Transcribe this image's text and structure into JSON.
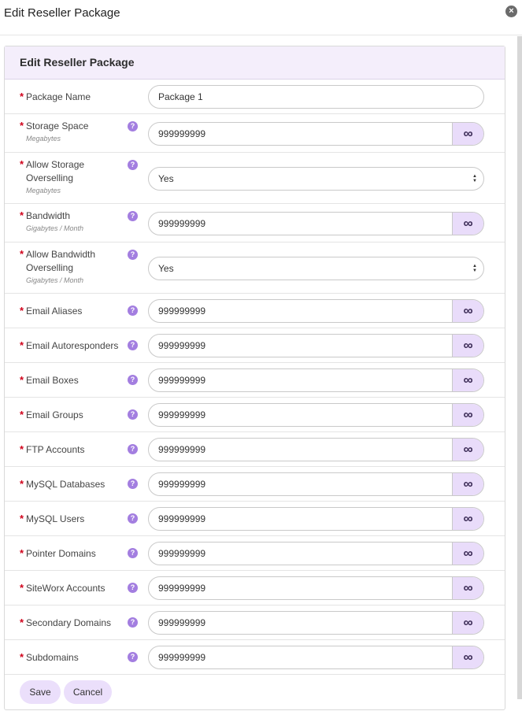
{
  "dialog": {
    "title": "Edit Reseller Package",
    "close_glyph": "×"
  },
  "panel": {
    "header": "Edit Reseller Package"
  },
  "required_mark": "*",
  "help_glyph": "?",
  "infinity_glyph": "∞",
  "select_caret_up": "▲",
  "select_caret_down": "▼",
  "rows": [
    {
      "label": "Package Name",
      "value": "Package 1",
      "type": "text"
    },
    {
      "label": "Storage Space",
      "sub": "Megabytes",
      "value": "999999999",
      "type": "number"
    },
    {
      "label": "Allow Storage Overselling",
      "sub": "Megabytes",
      "value": "Yes",
      "type": "select"
    },
    {
      "label": "Bandwidth",
      "sub": "Gigabytes / Month",
      "value": "999999999",
      "type": "number"
    },
    {
      "label": "Allow Bandwidth Overselling",
      "sub": "Gigabytes / Month",
      "value": "Yes",
      "type": "select"
    },
    {
      "label": "Email Aliases",
      "value": "999999999",
      "type": "number"
    },
    {
      "label": "Email Autoresponders",
      "value": "999999999",
      "type": "number"
    },
    {
      "label": "Email Boxes",
      "value": "999999999",
      "type": "number"
    },
    {
      "label": "Email Groups",
      "value": "999999999",
      "type": "number"
    },
    {
      "label": "FTP Accounts",
      "value": "999999999",
      "type": "number"
    },
    {
      "label": "MySQL Databases",
      "value": "999999999",
      "type": "number"
    },
    {
      "label": "MySQL Users",
      "value": "999999999",
      "type": "number"
    },
    {
      "label": "Pointer Domains",
      "value": "999999999",
      "type": "number"
    },
    {
      "label": "SiteWorx Accounts",
      "value": "999999999",
      "type": "number"
    },
    {
      "label": "Secondary Domains",
      "value": "999999999",
      "type": "number"
    },
    {
      "label": "Subdomains",
      "value": "999999999",
      "type": "number"
    }
  ],
  "buttons": {
    "save": "Save",
    "cancel": "Cancel"
  }
}
